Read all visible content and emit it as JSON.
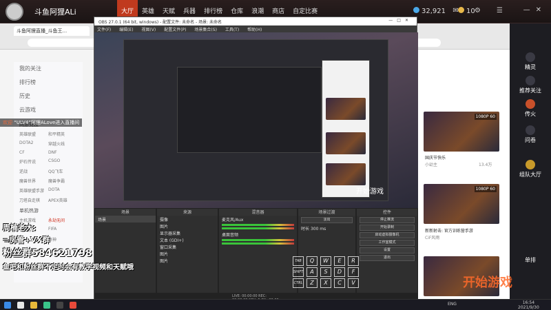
{
  "topbar": {
    "channel_name": "斗鱼阿狸ALi",
    "nav": [
      "大厅",
      "英雄",
      "天赋",
      "兵器",
      "排行榜",
      "仓库",
      "浪潮",
      "商店",
      "自定比赛"
    ],
    "coins": "32,921",
    "coins2": "10"
  },
  "browser": {
    "tab_title": "斗鱼阿狸直播_斗鱼王..."
  },
  "left_overlay": {
    "items": [
      "我的关注",
      "排行榜",
      "历史",
      "云游戏"
    ],
    "section_label": "网游竞技",
    "games": [
      "英雄联盟",
      "和平精英",
      "DOTA2",
      "穿越火线",
      "CF",
      "DNF",
      "炉石传说",
      "CSGO",
      "逆战",
      "QQ飞车",
      "魔兽世界",
      "魔兽争霸",
      "英雄联盟手游",
      "DOTA",
      "刀塔自走棋",
      "APEX英雄"
    ],
    "section2": "单机热游",
    "games2": [
      "主机游戏",
      "永劫无间",
      "怀旧游戏",
      "FIFA",
      "",
      "原神"
    ]
  },
  "danmu": {
    "prefix": "欢迎",
    "text": "“ULV4”阿狸ALove进入直播间"
  },
  "promo": {
    "line1": "周楠老大:",
    "line2": "=房管+VX群",
    "line3": "粉丝群584621798",
    "line4": "鱼吧和粉丝群不定时会有教学视频和天赋哦"
  },
  "obs": {
    "title": "OBS 27.0.1 (64 bit, windows) - 配置文件: 未命名 - 场景: 未命名",
    "menu": [
      "文件(F)",
      "编辑(E)",
      "视图(V)",
      "配置文件(P)",
      "场景集合(S)",
      "工具(T)",
      "帮助(H)"
    ],
    "panels": {
      "scenes": "场景",
      "sources": "来源",
      "mixer": "混音器",
      "transitions": "场景过渡",
      "controls": "控件"
    },
    "scene_name": "场景",
    "sources": [
      "摄像",
      "图片",
      "显示器采集",
      "文本 (GDI+)",
      "窗口采集",
      "图片",
      "图片"
    ],
    "mixer": [
      "麦克风/Aux",
      "桌面音频"
    ],
    "transition": {
      "type": "淡出",
      "duration_label": "时长",
      "duration": "300 ms"
    },
    "controls": [
      "停止推流",
      "开始录制",
      "启动虚拟摄像机",
      "工作室模式",
      "设置",
      "退出"
    ],
    "status": "LIVE: 00:00:00   REC: 00:00:00   CPU: 5.3%, 30.00 fps"
  },
  "keyboard": {
    "row1": [
      "TAB",
      "Q",
      "W",
      "E",
      "R"
    ],
    "row2": [
      "SHIFT",
      "A",
      "S",
      "D",
      "F"
    ],
    "row3": [
      "CTRL",
      "Z",
      "X",
      "C",
      "V"
    ]
  },
  "right_bar": {
    "items": [
      "精灵",
      "推荐关注",
      "传火",
      "问卷",
      "组队大厅",
      "单排"
    ]
  },
  "right_cards": [
    {
      "tag": "1080P 60",
      "title": "国庆节快乐",
      "author": "小幼主",
      "count": "13.4万"
    },
    {
      "tag": "1080P 60",
      "title": "新新射击: 官方训练营手游",
      "author": "CiF风雨",
      "count": ""
    },
    {
      "tag": "",
      "title": "",
      "author": "",
      "count": ""
    }
  ],
  "kaishi": "开始游戏",
  "taskbar": {
    "tray": "ENG",
    "time": "16:54",
    "date": "2021/9/30"
  }
}
